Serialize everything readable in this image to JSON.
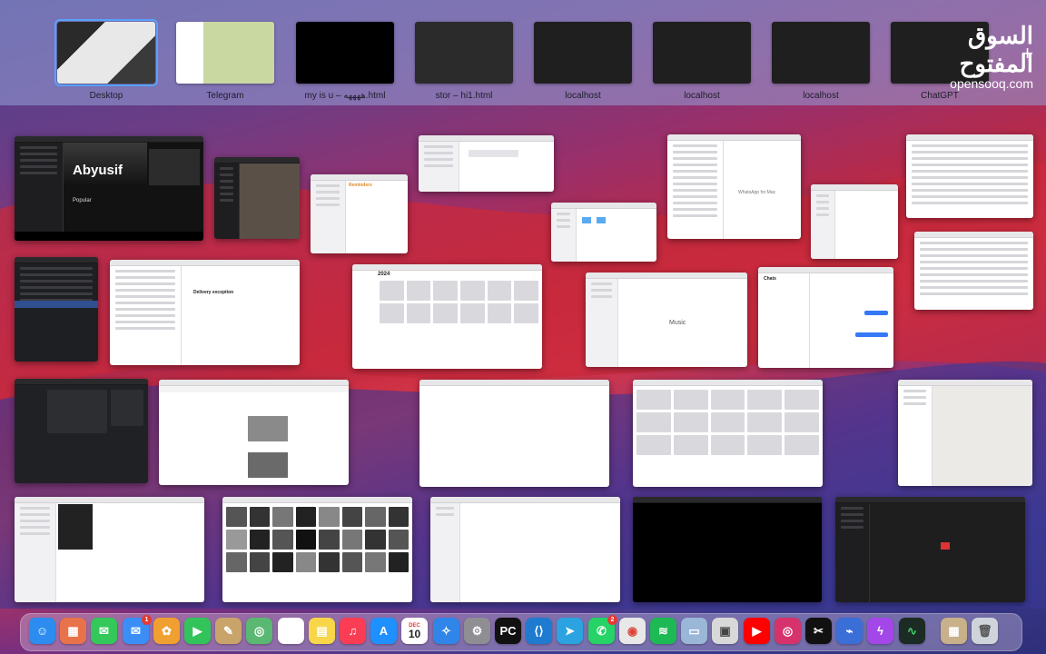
{
  "spaces": [
    {
      "label": "Desktop",
      "active": true,
      "thumb": "desktop"
    },
    {
      "label": "Telegram",
      "active": false,
      "thumb": "telegram"
    },
    {
      "label": "my is u – ههههه.html",
      "active": false,
      "thumb": "black"
    },
    {
      "label": "stor – hi1.html",
      "active": false,
      "thumb": "code"
    },
    {
      "label": "localhost",
      "active": false,
      "thumb": "dark"
    },
    {
      "label": "localhost",
      "active": false,
      "thumb": "dark"
    },
    {
      "label": "localhost",
      "active": false,
      "thumb": "dark"
    },
    {
      "label": "ChatGPT",
      "active": false,
      "thumb": "dark"
    }
  ],
  "watermark": {
    "arabic": "السوق المفتوح",
    "latin": "opensooq.com"
  },
  "windows": {
    "spotify": {
      "artist": "Abyusif",
      "section": "Popular"
    },
    "reminders": {
      "title": "Reminders"
    },
    "calendar": {
      "year": "2024"
    },
    "music": {
      "title": "Music"
    },
    "mail": {
      "subject": "Delivery exception"
    },
    "whatsapp": {
      "empty_state": "WhatsApp for Mac"
    },
    "chats": {
      "title": "Chats"
    }
  },
  "dock": [
    {
      "name": "finder-icon",
      "glyph": "☺",
      "color": "#2d8cf0"
    },
    {
      "name": "launchpad-icon",
      "glyph": "▦",
      "color": "#e8734a"
    },
    {
      "name": "messages-icon",
      "glyph": "✉",
      "color": "#34c759"
    },
    {
      "name": "mail-icon",
      "glyph": "✉",
      "color": "#3a8ef6",
      "badge": "1"
    },
    {
      "name": "photos-icon",
      "glyph": "✿",
      "color": "#f0a030"
    },
    {
      "name": "facetime-icon",
      "glyph": "▶",
      "color": "#32c45a"
    },
    {
      "name": "notes-icon",
      "glyph": "✎",
      "color": "#c9a46a"
    },
    {
      "name": "maps-icon",
      "glyph": "◎",
      "color": "#5ab872"
    },
    {
      "name": "reminders-icon",
      "glyph": "☰",
      "color": "#ffffff"
    },
    {
      "name": "notes2-icon",
      "glyph": "▤",
      "color": "#f7d64a"
    },
    {
      "name": "music-icon",
      "glyph": "♫",
      "color": "#fa3d55"
    },
    {
      "name": "appstore-icon",
      "glyph": "A",
      "color": "#1e90ff"
    },
    {
      "name": "calendar-icon",
      "glyph": "10",
      "color": "#ffffff",
      "text_color": "#222",
      "label": "DEC"
    },
    {
      "name": "safari-icon",
      "glyph": "✧",
      "color": "#2f86e8"
    },
    {
      "name": "settings-icon",
      "glyph": "⚙",
      "color": "#8e8e93"
    },
    {
      "name": "pycharm-icon",
      "glyph": "PC",
      "color": "#111111"
    },
    {
      "name": "vscode-icon",
      "glyph": "⟨⟩",
      "color": "#1f7bd0"
    },
    {
      "name": "telegram-icon",
      "glyph": "➤",
      "color": "#2aa3e0"
    },
    {
      "name": "whatsapp-icon",
      "glyph": "✆",
      "color": "#25d366",
      "badge": "2"
    },
    {
      "name": "chrome-icon",
      "glyph": "◉",
      "color": "#e8e8e8",
      "text_color": "#db4437"
    },
    {
      "name": "spotify-icon",
      "glyph": "≋",
      "color": "#1db954"
    },
    {
      "name": "preview-icon",
      "glyph": "▭",
      "color": "#9ab7d8"
    },
    {
      "name": "archive-icon",
      "glyph": "▣",
      "color": "#d8d8d8",
      "text_color": "#444"
    },
    {
      "name": "youtube-icon",
      "glyph": "▶",
      "color": "#ff0000"
    },
    {
      "name": "instagram-icon",
      "glyph": "◎",
      "color": "#d6336c"
    },
    {
      "name": "capcut-icon",
      "glyph": "✂",
      "color": "#111111"
    },
    {
      "name": "network-icon",
      "glyph": "⌁",
      "color": "#3b6fd8"
    },
    {
      "name": "messenger-icon",
      "glyph": "ϟ",
      "color": "#a347e8"
    },
    {
      "name": "activity-icon",
      "glyph": "∿",
      "color": "#1c2b24",
      "text_color": "#3fd06a"
    },
    {
      "name": "downloads-icon",
      "glyph": "▦",
      "color": "#c8b08a"
    },
    {
      "name": "trash-icon",
      "glyph": "🗑",
      "color": "#cfd4da",
      "text_color": "#555"
    }
  ]
}
